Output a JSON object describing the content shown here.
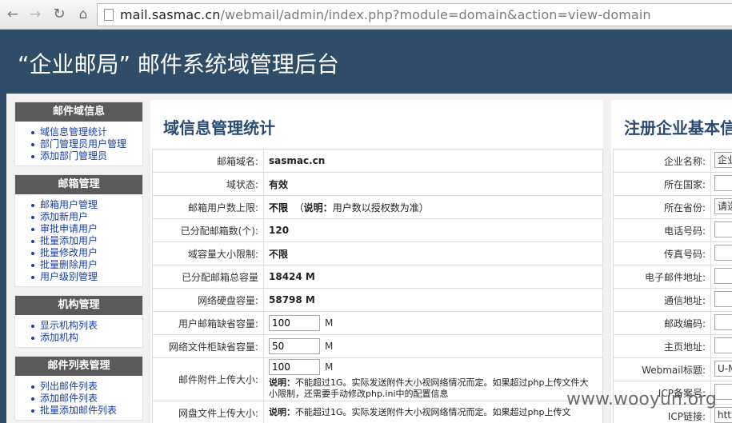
{
  "browser": {
    "url_host": "mail.sasmac.cn",
    "url_path": "/webmail/admin/index.php?module=domain&action=view-domain"
  },
  "header": {
    "title": "“企业邮局” 邮件系统域管理后台"
  },
  "sidebar": [
    {
      "title": "邮件域信息",
      "items": [
        "域信息管理统计",
        "部门管理员用户管理",
        "添加部门管理员"
      ]
    },
    {
      "title": "邮箱管理",
      "items": [
        "邮箱用户管理",
        "添加新用户",
        "审批申请用户",
        "批量添加用户",
        "批量修改用户",
        "批量删除用户",
        "用户级别管理"
      ]
    },
    {
      "title": "机构管理",
      "items": [
        "显示机构列表",
        "添加机构"
      ]
    },
    {
      "title": "邮件列表管理",
      "items": [
        "列出邮件列表",
        "添加邮件列表",
        "批量添加邮件列表"
      ]
    }
  ],
  "main": {
    "title": "域信息管理统计",
    "rows": {
      "domain_label": "邮箱域名:",
      "domain_value": "sasmac.cn",
      "status_label": "域状态:",
      "status_value": "有效",
      "user_limit_label": "邮箱用户数上限:",
      "user_limit_value": "不限",
      "user_limit_note_key": "说明：",
      "user_limit_note": "用户数以授权数为准）",
      "user_limit_note_open": "（",
      "allocated_label": "已分配邮箱数(个):",
      "allocated_value": "120",
      "capacity_limit_label": "域容量大小限制:",
      "capacity_limit_value": "不限",
      "allocated_total_label": "已分配邮箱总容量",
      "allocated_total_value": "18424 M",
      "disk_label": "网络硬盘容量:",
      "disk_value": "58798 M",
      "mailbox_default_label": "用户邮箱缺省容量:",
      "mailbox_default_value": "100",
      "mailbox_default_unit": "M",
      "filecab_default_label": "网络文件柜缺省容量:",
      "filecab_default_value": "50",
      "filecab_default_unit": "M",
      "attach_label": "邮件附件上传大小:",
      "attach_value": "100",
      "attach_unit": "M",
      "attach_note_key": "说明：",
      "attach_note": "不能超过1G。实际发送附件大小视网络情况而定。如果超过php上传文件大小限制，还需要手动修改php.ini中的配置信息",
      "netfile_label": "网盘文件上传大小:",
      "netfile_note_key": "说明：",
      "netfile_note": "不能超过1G。实际发送附件大小视网络情况而定。如果超过php上传文"
    }
  },
  "right": {
    "title": "注册企业基本信",
    "rows": [
      {
        "label": "企业名称:",
        "value": "企业"
      },
      {
        "label": "所在国家:",
        "value": ""
      },
      {
        "label": "所在省份:",
        "value": "请选"
      },
      {
        "label": "电话号码:",
        "value": ""
      },
      {
        "label": "传真号码:",
        "value": ""
      },
      {
        "label": "电子邮件地址:",
        "value": ""
      },
      {
        "label": "通信地址:",
        "value": ""
      },
      {
        "label": "邮政编码:",
        "value": ""
      },
      {
        "label": "主页地址:",
        "value": ""
      },
      {
        "label": "Webmail标题:",
        "value": "U-M"
      },
      {
        "label": "ICP备案号:",
        "value": ""
      },
      {
        "label": "ICP链接:",
        "value": "http"
      }
    ]
  },
  "watermark": "www.wooyun.org"
}
